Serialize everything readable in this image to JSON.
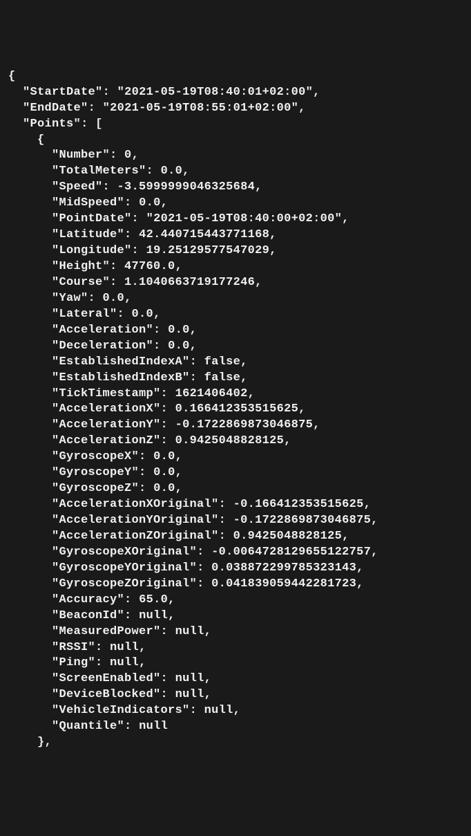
{
  "json_data": {
    "open": "{",
    "line1_key": "StartDate",
    "line1_val": "2021-05-19T08:40:01+02:00",
    "line2_key": "EndDate",
    "line2_val": "2021-05-19T08:55:01+02:00",
    "line3_key": "Points",
    "line3_open": "[",
    "line4_open": "{",
    "p": {
      "Number": "0",
      "TotalMeters": "0.0",
      "Speed": "-3.5999999046325684",
      "MidSpeed": "0.0",
      "PointDate": "2021-05-19T08:40:00+02:00",
      "Latitude": "42.440715443771168",
      "Longitude": "19.25129577547029",
      "Height": "47760.0",
      "Course": "1.1040663719177246",
      "Yaw": "0.0",
      "Lateral": "0.0",
      "Acceleration": "0.0",
      "Deceleration": "0.0",
      "EstablishedIndexA": "false",
      "EstablishedIndexB": "false",
      "TickTimestamp": "1621406402",
      "AccelerationX": "0.166412353515625",
      "AccelerationY": "-0.1722869873046875",
      "AccelerationZ": "0.9425048828125",
      "GyroscopeX": "0.0",
      "GyroscopeY": "0.0",
      "GyroscopeZ": "0.0",
      "AccelerationXOriginal": "-0.166412353515625",
      "AccelerationYOriginal": "-0.1722869873046875",
      "AccelerationZOriginal": "0.9425048828125",
      "GyroscopeXOriginal": "-0.0064728129655122757",
      "GyroscopeYOriginal": "0.038872299785323143",
      "GyroscopeZOriginal": "0.041839059442281723",
      "Accuracy": "65.0",
      "BeaconId": "null",
      "MeasuredPower": "null",
      "RSSI": "null",
      "Ping": "null",
      "ScreenEnabled": "null",
      "DeviceBlocked": "null",
      "VehicleIndicators": "null",
      "Quantile": "null"
    },
    "close_brace": "},"
  }
}
